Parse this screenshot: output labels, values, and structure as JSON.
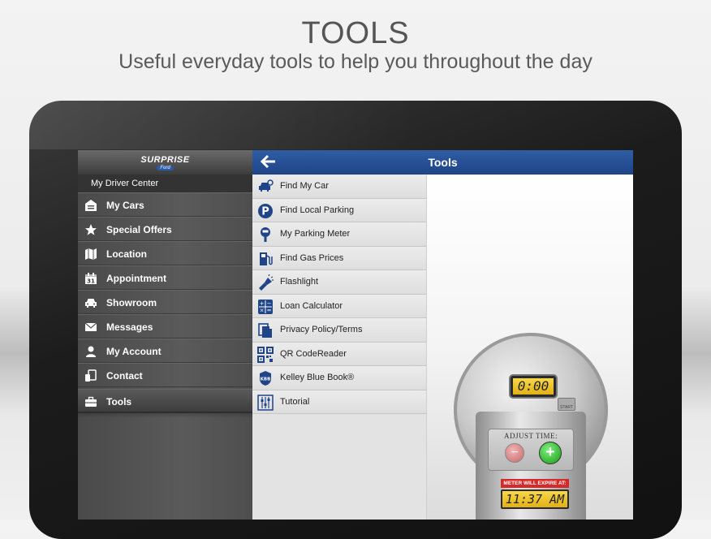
{
  "promo": {
    "title": "TOOLS",
    "subtitle": "Useful everyday tools to help you throughout the day"
  },
  "brand": {
    "name": "SURPRISE",
    "sub": "Ford"
  },
  "sidebar": {
    "header": "My Driver Center",
    "items": [
      {
        "label": "My Cars",
        "icon": "garage-icon"
      },
      {
        "label": "Special Offers",
        "icon": "star-icon"
      },
      {
        "label": "Location",
        "icon": "map-icon"
      },
      {
        "label": "Appointment",
        "icon": "calendar-icon"
      },
      {
        "label": "Showroom",
        "icon": "car-icon"
      },
      {
        "label": "Messages",
        "icon": "envelope-icon"
      },
      {
        "label": "My Account",
        "icon": "person-icon"
      },
      {
        "label": "Contact",
        "icon": "phone-icon"
      },
      {
        "label": "Tools",
        "icon": "toolbox-icon",
        "active": true
      }
    ]
  },
  "topbar": {
    "title": "Tools"
  },
  "tools": [
    {
      "label": "Find My Car",
      "icon": "car-locate-icon"
    },
    {
      "label": "Find Local Parking",
      "icon": "parking-icon"
    },
    {
      "label": "My Parking Meter",
      "icon": "parking-meter-icon"
    },
    {
      "label": "Find Gas Prices",
      "icon": "gas-pump-icon"
    },
    {
      "label": "Flashlight",
      "icon": "flashlight-icon"
    },
    {
      "label": "Loan Calculator",
      "icon": "calculator-icon"
    },
    {
      "label": "Privacy Policy/Terms",
      "icon": "document-icon"
    },
    {
      "label": "QR CodeReader",
      "icon": "qr-code-icon"
    },
    {
      "label": "Kelley Blue Book®",
      "icon": "kbb-icon"
    },
    {
      "label": "Tutorial",
      "icon": "sliders-icon"
    }
  ],
  "meter": {
    "display": "0:00",
    "start_label": "START",
    "adjust_label": "ADJUST TIME:",
    "minus": "−",
    "plus": "+",
    "expire_label": "METER WILL EXPIRE AT:",
    "expire_time": "11:37 AM"
  },
  "colors": {
    "accent_blue": "#1f4487",
    "icon_blue": "#1f4487"
  }
}
